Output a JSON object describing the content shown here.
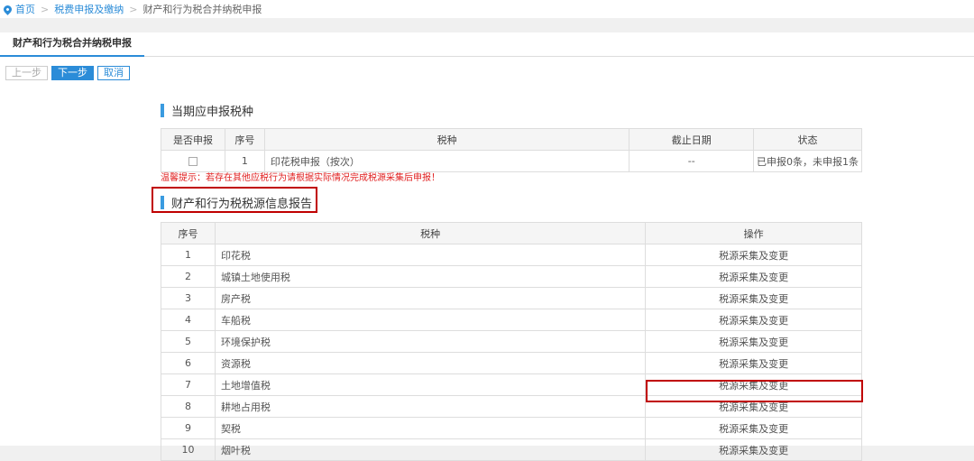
{
  "breadcrumb": {
    "home": "首页",
    "level2": "税费申报及缴纳",
    "current": "财产和行为税合并纳税申报"
  },
  "tab": {
    "label": "财产和行为税合并纳税申报"
  },
  "toolbar": {
    "prev": "上一步",
    "next": "下一步",
    "cancel": "取消"
  },
  "section1": {
    "title": "当期应申报税种",
    "headers": [
      "是否申报",
      "序号",
      "税种",
      "截止日期",
      "状态"
    ],
    "row": {
      "index": "1",
      "tax": "印花税申报（按次）",
      "deadline": "--",
      "status": "已申报0条，未申报1条"
    }
  },
  "warning": "温馨提示：若存在其他应税行为请根据实际情况完成税源采集后申报！",
  "section2": {
    "title": "财产和行为税税源信息报告",
    "headers": [
      "序号",
      "税种",
      "操作"
    ],
    "action_label": "税源采集及变更",
    "rows": [
      {
        "index": "1",
        "tax": "印花税"
      },
      {
        "index": "2",
        "tax": "城镇土地使用税"
      },
      {
        "index": "3",
        "tax": "房产税"
      },
      {
        "index": "4",
        "tax": "车船税"
      },
      {
        "index": "5",
        "tax": "环境保护税"
      },
      {
        "index": "6",
        "tax": "资源税"
      },
      {
        "index": "7",
        "tax": "土地增值税"
      },
      {
        "index": "8",
        "tax": "耕地占用税"
      },
      {
        "index": "9",
        "tax": "契税"
      },
      {
        "index": "10",
        "tax": "烟叶税"
      }
    ]
  },
  "colors": {
    "accent": "#2b8cd8",
    "highlight_border": "#c00000",
    "warning": "#e02020"
  }
}
